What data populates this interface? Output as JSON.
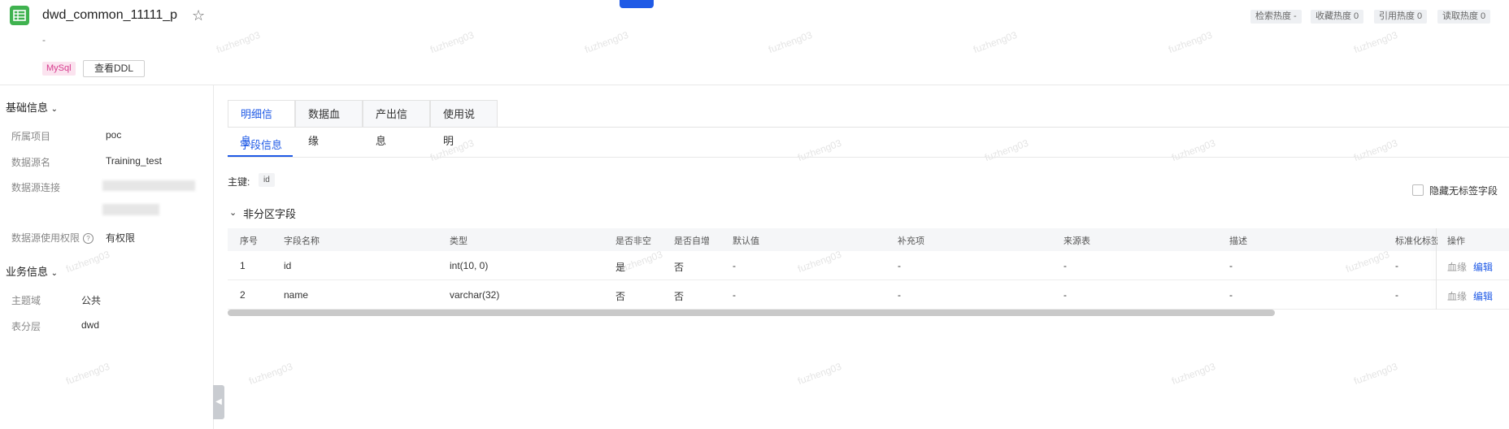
{
  "header": {
    "title": "dwd_common_11111_p",
    "description": "-",
    "db_tag": "MySql",
    "ddl_button": "查看DDL",
    "stats": [
      "检索热度 -",
      "收藏热度 0",
      "引用热度 0",
      "读取热度 0"
    ]
  },
  "watermark": "fuzheng03",
  "sidebar": {
    "basic_title": "基础信息",
    "basic_items": [
      {
        "label": "所属项目",
        "value": "poc"
      },
      {
        "label": "数据源名",
        "value": "Training_test"
      },
      {
        "label": "数据源连接",
        "value": ""
      },
      {
        "label": "数据源使用权限",
        "value": "有权限"
      }
    ],
    "business_title": "业务信息",
    "business_items": [
      {
        "label": "主题域",
        "value": "公共"
      },
      {
        "label": "表分层",
        "value": "dwd"
      }
    ]
  },
  "tabs": [
    "明细信息",
    "数据血缘",
    "产出信息",
    "使用说明"
  ],
  "subtab": "字段信息",
  "primary_key_label": "主键:",
  "primary_key": "id",
  "hide_untagged_label": "隐藏无标签字段",
  "group_title": "非分区字段",
  "table": {
    "columns": [
      "序号",
      "字段名称",
      "类型",
      "是否非空",
      "是否自增",
      "默认值",
      "补充项",
      "来源表",
      "描述",
      "标准化标签",
      "操作"
    ],
    "rows": [
      [
        "1",
        "id",
        "int(10, 0)",
        "是",
        "否",
        "-",
        "-",
        "-",
        "-",
        "-"
      ],
      [
        "2",
        "name",
        "varchar(32)",
        "否",
        "否",
        "-",
        "-",
        "-",
        "-",
        "-"
      ]
    ],
    "action_lineage": "血缘",
    "action_edit": "编辑"
  },
  "colors": {
    "accent": "#1f5ae6",
    "app_icon": "#3fb24f",
    "mysql_tag": "#d63a8d"
  }
}
